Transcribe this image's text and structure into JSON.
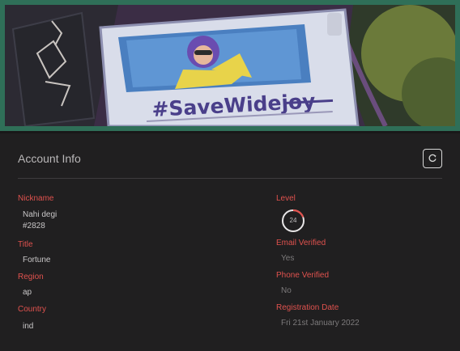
{
  "banner": {
    "image_label": "#SaveWidejoy",
    "frame_color": "#2f6f58"
  },
  "account_info": {
    "title": "Account Info",
    "refresh_icon": "refresh-icon"
  },
  "fields_left": {
    "nickname_label": "Nickname",
    "nickname_value_line1": "Nahi degi",
    "nickname_value_line2": "#2828",
    "title_label": "Title",
    "title_value": "Fortune",
    "region_label": "Region",
    "region_value": "ap",
    "country_label": "Country",
    "country_value": "ind"
  },
  "fields_right": {
    "level_label": "Level",
    "level_value": "24",
    "email_label": "Email Verified",
    "email_value": "Yes",
    "phone_label": "Phone Verified",
    "phone_value": "No",
    "registration_label": "Registration Date",
    "registration_value": "Fri 21st January 2022"
  },
  "colors": {
    "accent_label": "#e0524e",
    "background": "#201f20"
  }
}
